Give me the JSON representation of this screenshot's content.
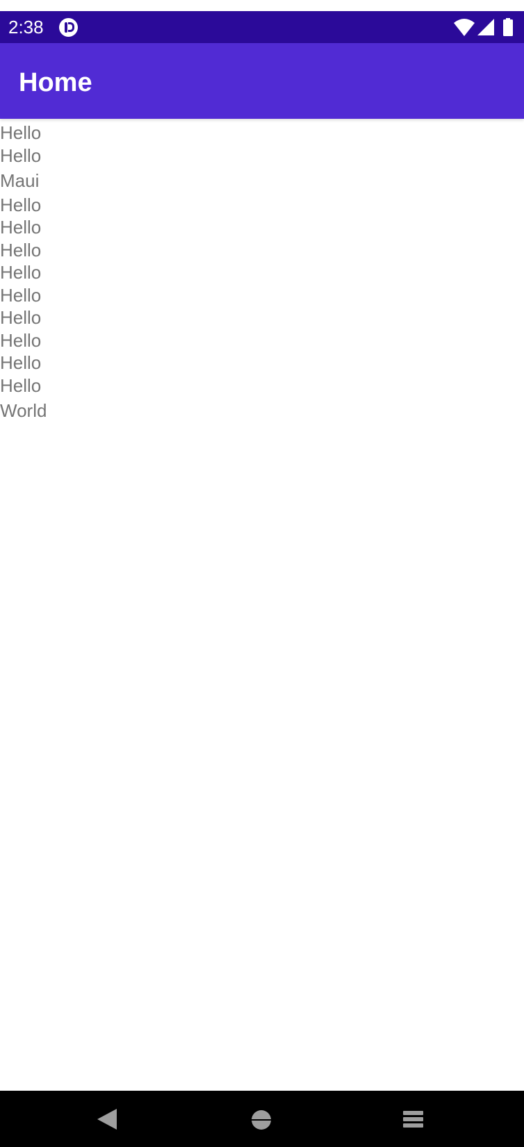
{
  "status_bar": {
    "time": "2:38",
    "icons": [
      "notification-app-icon",
      "wifi-icon",
      "cellular-signal-icon",
      "battery-icon"
    ]
  },
  "app_bar": {
    "title": "Home"
  },
  "content": {
    "lines": [
      "Hello",
      "Hello",
      "Maui",
      "Hello",
      "Hello",
      "Hello",
      "Hello",
      "Hello",
      "Hello",
      "Hello",
      "Hello",
      "Hello",
      "World"
    ]
  },
  "nav_bar": {
    "icons": [
      "back-icon",
      "home-icon",
      "recents-icon"
    ]
  },
  "colors": {
    "status_bar": "#2b0a99",
    "app_bar": "#512bd4",
    "text": "#757575",
    "nav_bar": "#000000"
  }
}
